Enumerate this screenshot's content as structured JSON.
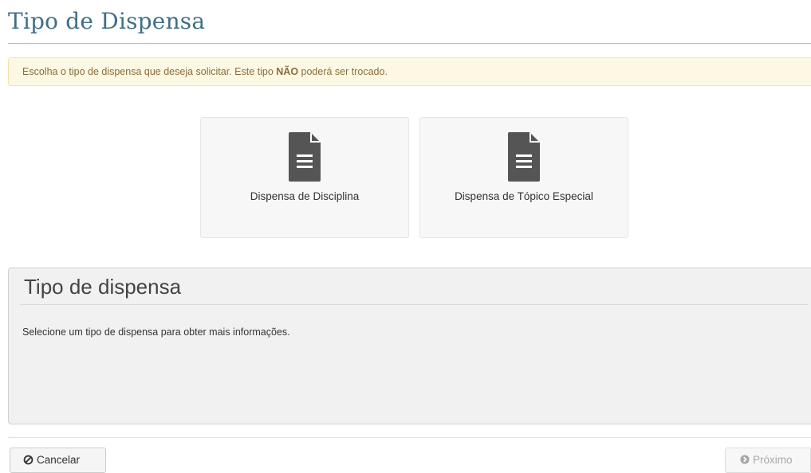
{
  "header": {
    "title": "Tipo de Dispensa"
  },
  "alert": {
    "text_before": "Escolha o tipo de dispensa que deseja solicitar. Este tipo ",
    "text_bold": "NÃO",
    "text_after": " poderá ser trocado."
  },
  "options": [
    {
      "label": "Dispensa de Disciplina",
      "icon": "document-icon"
    },
    {
      "label": "Dispensa de Tópico Especial",
      "icon": "document-icon"
    }
  ],
  "info": {
    "title": "Tipo de dispensa",
    "text": "Selecione um tipo de dispensa para obter mais informações."
  },
  "footer": {
    "cancel_label": "Cancelar",
    "cancel_icon": "ban-icon",
    "next_label": "Próximo",
    "next_icon": "circle-arrow-right-icon"
  },
  "colors": {
    "title": "#3f6f86",
    "alert_bg": "#fcf8e3",
    "alert_text": "#8a6d3b",
    "icon": "#555555"
  }
}
